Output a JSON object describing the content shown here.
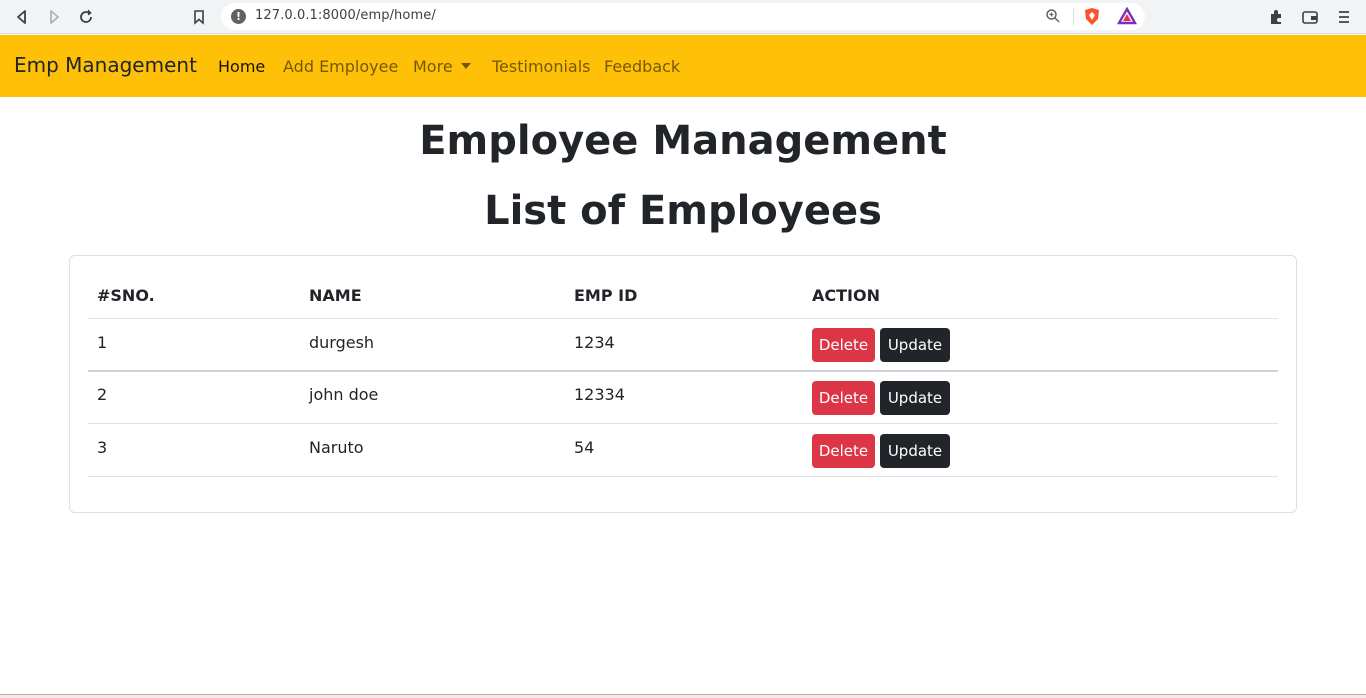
{
  "browser": {
    "url": "127.0.0.1:8000/emp/home/"
  },
  "navbar": {
    "brand": "Emp Management",
    "links": [
      {
        "label": "Home"
      },
      {
        "label": "Add Employee"
      },
      {
        "label": "More"
      },
      {
        "label": "Testimonials"
      },
      {
        "label": "Feedback"
      }
    ],
    "color": "#ffc107"
  },
  "headings": {
    "title": "Employee Management",
    "subtitle": "List of Employees"
  },
  "table": {
    "headers": [
      "#SNO.",
      "NAME",
      "EMP ID",
      "ACTION"
    ],
    "rows": [
      {
        "sno": "1",
        "name": "durgesh",
        "emp_id": "1234"
      },
      {
        "sno": "2",
        "name": "john doe",
        "emp_id": "12334"
      },
      {
        "sno": "3",
        "name": "Naruto",
        "emp_id": "54"
      }
    ],
    "delete_label": "Delete",
    "update_label": "Update"
  },
  "colors": {
    "danger": "#dc3545",
    "dark": "#212529"
  }
}
